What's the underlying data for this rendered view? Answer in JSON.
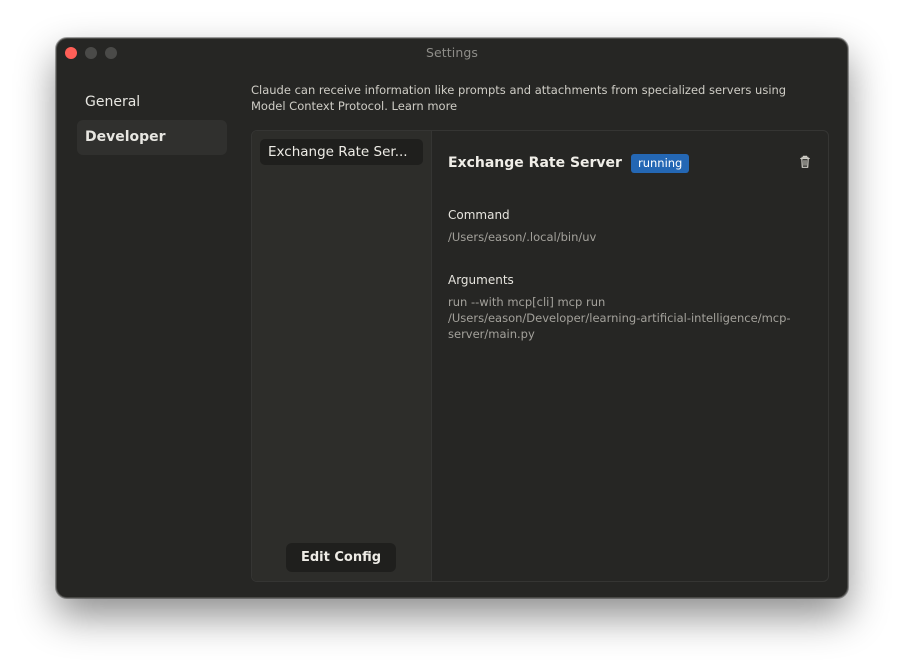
{
  "window": {
    "title": "Settings"
  },
  "nav": {
    "items": [
      {
        "label": "General"
      },
      {
        "label": "Developer"
      }
    ],
    "active": "Developer"
  },
  "description": "Claude can receive information like prompts and attachments from specialized servers using Model Context Protocol. Learn more",
  "servers": {
    "list": [
      {
        "label": "Exchange Rate Ser..."
      }
    ],
    "edit_config_label": "Edit Config"
  },
  "detail": {
    "name": "Exchange Rate Server",
    "status": "running",
    "command_label": "Command",
    "command_value": "/Users/eason/.local/bin/uv",
    "arguments_label": "Arguments",
    "arguments_lines": [
      "run --with mcp[cli] mcp run",
      "/Users/eason/Developer/learning-artificial-intelligence/mcp-",
      "server/main.py"
    ]
  },
  "icons": {
    "close": "close-button-icon",
    "minimize": "minimize-button-icon",
    "maximize": "maximize-button-icon",
    "delete": "trash-icon"
  },
  "colors": {
    "status_badge": "#2467b4",
    "close_button": "#ff5f57",
    "window_bg": "#262624"
  }
}
